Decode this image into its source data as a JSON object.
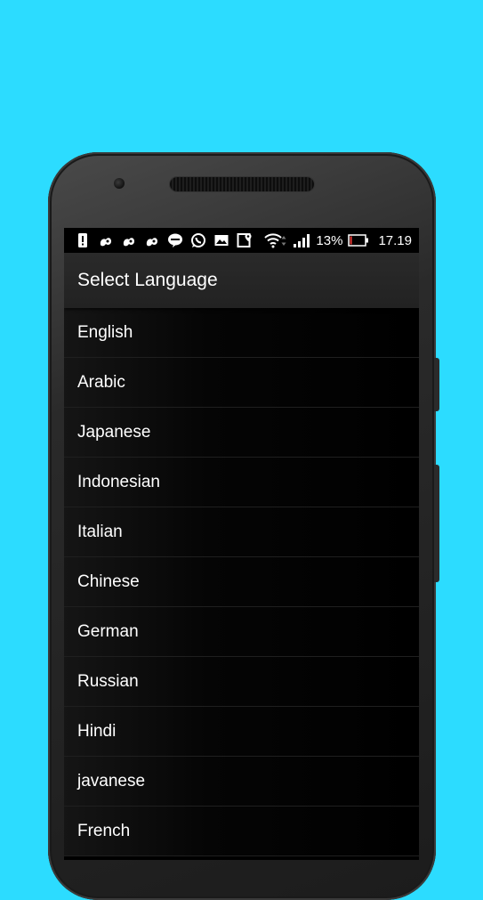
{
  "status_bar": {
    "icons": [
      "alert-icon",
      "uc-browser-icon",
      "uc-browser-icon",
      "uc-browser-icon",
      "line-icon",
      "whatsapp-icon",
      "gallery-icon",
      "maps-icon",
      "wifi-icon",
      "signal-icon"
    ],
    "battery_percent": "13%",
    "battery_level": 0.13,
    "battery_color": "#e53935",
    "time": "17.19"
  },
  "app_bar": {
    "title": "Select Language"
  },
  "languages": [
    "English",
    "Arabic",
    "Japanese",
    "Indonesian",
    "Italian",
    "Chinese",
    "German",
    "Russian",
    "Hindi",
    "javanese",
    "French"
  ],
  "colors": {
    "background": "#2cdcff",
    "app_bar": "#222222",
    "list_background": "#000000",
    "text": "#ffffff"
  }
}
